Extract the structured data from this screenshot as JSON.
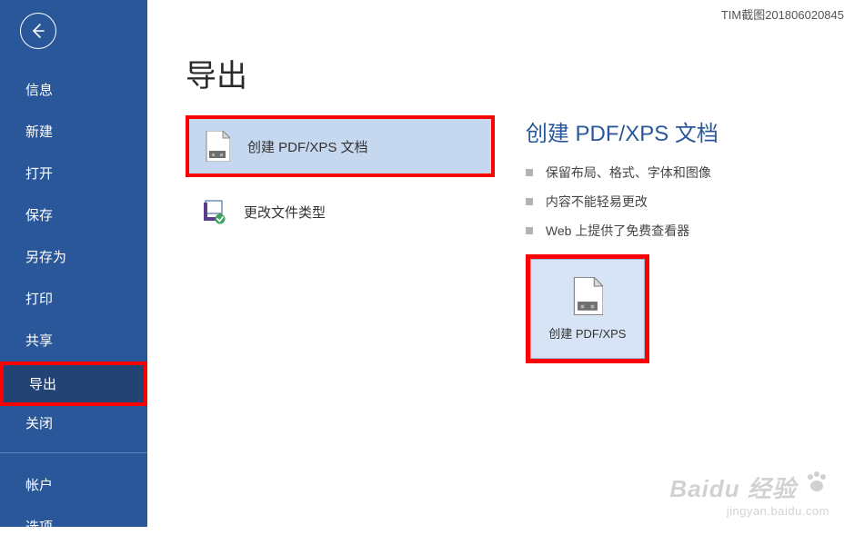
{
  "window": {
    "title": "TIM截图201806020845"
  },
  "sidebar": {
    "items": [
      {
        "label": "信息"
      },
      {
        "label": "新建"
      },
      {
        "label": "打开"
      },
      {
        "label": "保存"
      },
      {
        "label": "另存为"
      },
      {
        "label": "打印"
      },
      {
        "label": "共享"
      },
      {
        "label": "导出",
        "active": true
      },
      {
        "label": "关闭"
      }
    ],
    "footer": [
      {
        "label": "帐户"
      },
      {
        "label": "选项"
      }
    ]
  },
  "main": {
    "title": "导出",
    "options": [
      {
        "label": "创建 PDF/XPS 文档",
        "icon": "page-pdf-icon",
        "selected": true
      },
      {
        "label": "更改文件类型",
        "icon": "page-change-icon",
        "selected": false
      }
    ],
    "detail": {
      "title": "创建 PDF/XPS 文档",
      "bullets": [
        "保留布局、格式、字体和图像",
        "内容不能轻易更改",
        "Web 上提供了免费查看器"
      ],
      "button_label": "创建 PDF/XPS"
    }
  },
  "watermark": {
    "main": "Baidu 经验",
    "sub": "jingyan.baidu.com"
  }
}
